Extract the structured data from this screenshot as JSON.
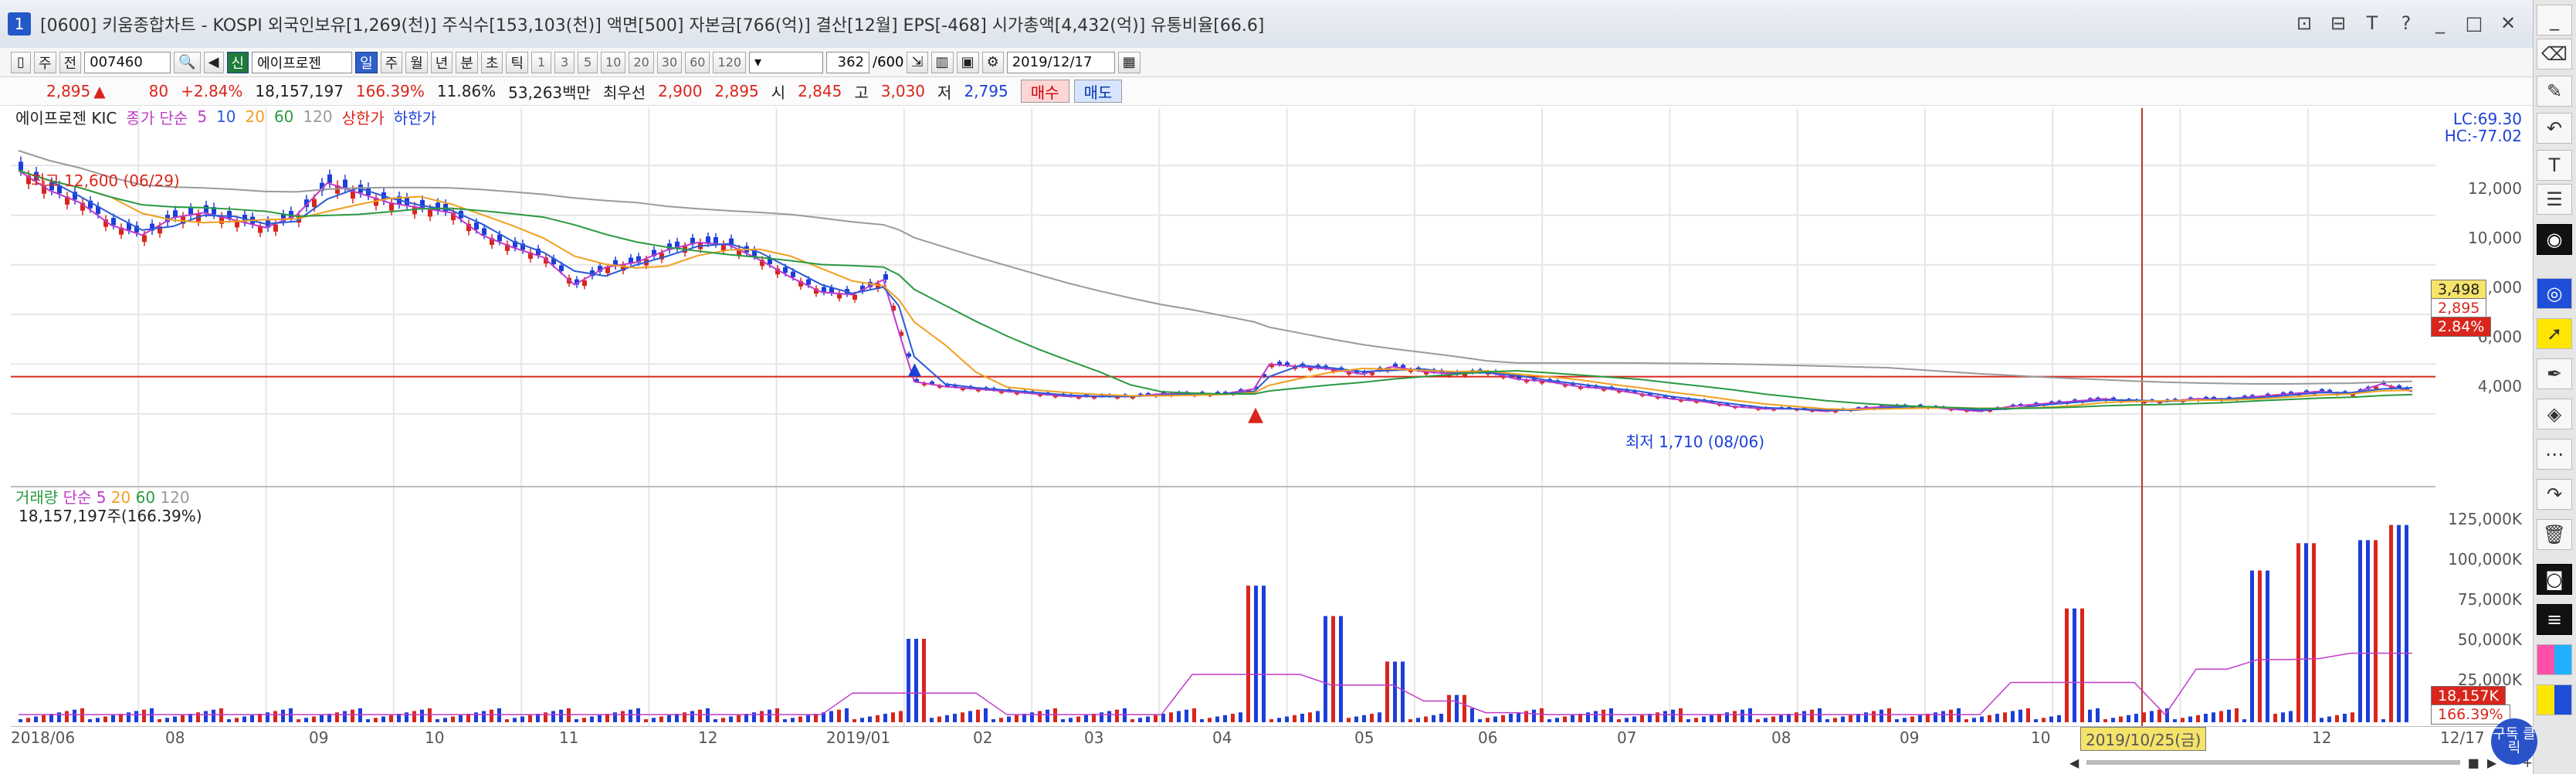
{
  "window": {
    "title_num": "1",
    "title": "[0600] 키움종합차트 - KOSPI 외국인보유[1,269(천)] 주식수[153,103(천)] 액면[500] 자본금[766(억)] 결산[12월] EPS[-468] 시가총액[4,432(억)] 유통비율[66.6]",
    "controls": [
      "⊡",
      "⊟",
      "T",
      "?",
      "_",
      "□",
      "✕"
    ]
  },
  "toolbar": {
    "items": [
      "주",
      "전"
    ],
    "code": "007460",
    "search_icon": "🔍",
    "sound_icon": "◀",
    "new_label": "신",
    "stock_name": "에이프로젠",
    "period_tabs": [
      "일",
      "주",
      "월",
      "년",
      "분",
      "초",
      "틱"
    ],
    "period_selected": 0,
    "numbers": [
      "1",
      "3",
      "5",
      "10",
      "20",
      "30",
      "60",
      "120"
    ],
    "count": "362",
    "total": "/600",
    "date": "2019/12/17"
  },
  "quote": {
    "price": "2,895",
    "change_arrow": "▲",
    "change": "80",
    "change_rate": "+2.84%",
    "volume": "18,157,197",
    "volume_rate": "166.39%",
    "turnover": "11.86%",
    "amount": "53,263백만",
    "best_label": "최우선",
    "best_ask": "2,900",
    "best_bid": "2,895",
    "open_label": "시",
    "open": "2,845",
    "high_label": "고",
    "high": "3,030",
    "low_label": "저",
    "low": "2,795",
    "buy": "매수",
    "sell": "매도"
  },
  "legend": {
    "name": "에이프로젠 KIC",
    "ma_label": "종가 단순",
    "ma_periods": [
      "5",
      "10",
      "20",
      "60",
      "120"
    ],
    "ma_colors": [
      "#c03bc9",
      "#2b5bd7",
      "#f0a020",
      "#2a9a40",
      "#9a9a9a"
    ],
    "upper": "상한가",
    "lower": "하한가"
  },
  "annotations": {
    "high": "최고 12,600 (06/29)",
    "low": "최저 1,710 (08/06)"
  },
  "volume_legend": {
    "label": "거래량",
    "ma_label": "단순",
    "periods": [
      "5",
      "20",
      "60",
      "120"
    ],
    "value": "18,157,197주(166.39%)"
  },
  "right_labels": {
    "lc": "LC:69.30",
    "hc": "HC:-77.02",
    "current_price": "3,498",
    "price2": "2,895",
    "price_rate": "2.84%",
    "vol_current": "18,157K",
    "vol_rate": "166.39%"
  },
  "crosshair_date": "2019/10/25(금)",
  "badge": "구독\n클릭",
  "colors": {
    "up": "#d9261c",
    "down": "#1c3fd9",
    "grid": "#e3e3e3"
  },
  "chart_data": {
    "type": "candlestick",
    "price_axis": {
      "min": 0,
      "max": 14000,
      "ticks": [
        "12,000",
        "10,000",
        "8,000",
        "6,000",
        "4,000"
      ]
    },
    "volume_axis": {
      "min": 0,
      "max": 140000,
      "unit": "K",
      "ticks": [
        "125,000K",
        "100,000K",
        "75,000K",
        "50,000K",
        "25,000K"
      ]
    },
    "x_ticks": [
      "2018/06",
      "08",
      "09",
      "10",
      "11",
      "12",
      "2019/01",
      "02",
      "03",
      "04",
      "05",
      "06",
      "07",
      "08",
      "09",
      "10",
      "11",
      "12",
      "12/17"
    ],
    "close_path": [
      [
        0,
        11800
      ],
      [
        4,
        11000
      ],
      [
        8,
        10500
      ],
      [
        12,
        9600
      ],
      [
        16,
        9200
      ],
      [
        20,
        9900
      ],
      [
        24,
        10100
      ],
      [
        28,
        9800
      ],
      [
        32,
        9500
      ],
      [
        36,
        10000
      ],
      [
        40,
        11300
      ],
      [
        44,
        10900
      ],
      [
        48,
        10500
      ],
      [
        52,
        10300
      ],
      [
        56,
        10100
      ],
      [
        60,
        9200
      ],
      [
        64,
        8700
      ],
      [
        68,
        8300
      ],
      [
        72,
        7200
      ],
      [
        76,
        7900
      ],
      [
        80,
        8100
      ],
      [
        84,
        8600
      ],
      [
        88,
        8900
      ],
      [
        92,
        8800
      ],
      [
        96,
        8200
      ],
      [
        100,
        7500
      ],
      [
        104,
        6900
      ],
      [
        108,
        6800
      ],
      [
        112,
        7400
      ],
      [
        114,
        5300
      ],
      [
        116,
        3300
      ],
      [
        120,
        3100
      ],
      [
        124,
        3000
      ],
      [
        128,
        2900
      ],
      [
        132,
        2800
      ],
      [
        136,
        2700
      ],
      [
        140,
        2700
      ],
      [
        144,
        2700
      ],
      [
        148,
        2800
      ],
      [
        152,
        2800
      ],
      [
        156,
        2800
      ],
      [
        160,
        3000
      ],
      [
        162,
        4000
      ],
      [
        166,
        3900
      ],
      [
        170,
        3800
      ],
      [
        174,
        3600
      ],
      [
        178,
        3900
      ],
      [
        182,
        3700
      ],
      [
        186,
        3600
      ],
      [
        190,
        3700
      ],
      [
        194,
        3400
      ],
      [
        198,
        3300
      ],
      [
        202,
        3100
      ],
      [
        206,
        3000
      ],
      [
        210,
        2800
      ],
      [
        214,
        2600
      ],
      [
        218,
        2500
      ],
      [
        222,
        2300
      ],
      [
        226,
        2200
      ],
      [
        230,
        2200
      ],
      [
        234,
        2100
      ],
      [
        238,
        2200
      ],
      [
        242,
        2300
      ],
      [
        246,
        2300
      ],
      [
        250,
        2200
      ],
      [
        254,
        2100
      ],
      [
        258,
        2300
      ],
      [
        262,
        2400
      ],
      [
        266,
        2500
      ],
      [
        270,
        2600
      ],
      [
        274,
        2500
      ],
      [
        278,
        2500
      ],
      [
        282,
        2600
      ],
      [
        286,
        2600
      ],
      [
        290,
        2700
      ],
      [
        294,
        2800
      ],
      [
        298,
        2900
      ],
      [
        302,
        2800
      ],
      [
        306,
        3200
      ],
      [
        310,
        2900
      ]
    ],
    "volume_spikes": [
      [
        116,
        55000
      ],
      [
        160,
        90000
      ],
      [
        170,
        70000
      ],
      [
        178,
        40000
      ],
      [
        186,
        18000
      ],
      [
        266,
        75000
      ],
      [
        290,
        100000
      ],
      [
        296,
        118000
      ],
      [
        304,
        120000
      ],
      [
        308,
        130000
      ]
    ]
  }
}
